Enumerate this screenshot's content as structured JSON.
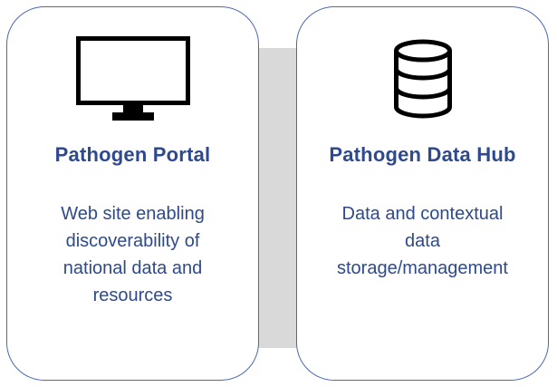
{
  "cards": [
    {
      "title": "Pathogen Portal",
      "description": "Web site enabling discoverability of national data and resources",
      "icon": "monitor-icon"
    },
    {
      "title": "Pathogen Data Hub",
      "description": "Data and contextual data storage/management",
      "icon": "database-icon"
    }
  ],
  "colors": {
    "card_border": "#4a67b8",
    "text": "#2e4a8c",
    "connector": "#d9d9d9",
    "icon": "#000000"
  }
}
